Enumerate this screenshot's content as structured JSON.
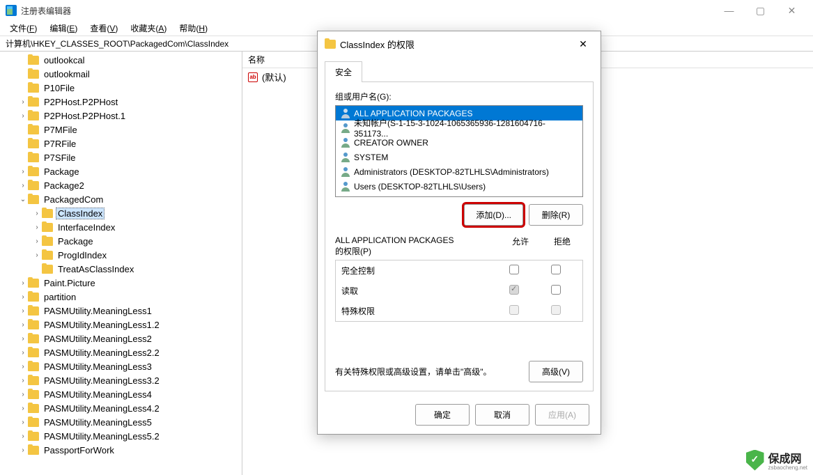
{
  "window": {
    "title": "注册表编辑器"
  },
  "menu": [
    {
      "label": "文件(F)"
    },
    {
      "label": "编辑(E)"
    },
    {
      "label": "查看(V)"
    },
    {
      "label": "收藏夹(A)"
    },
    {
      "label": "帮助(H)"
    }
  ],
  "address": "计算机\\HKEY_CLASSES_ROOT\\PackagedCom\\ClassIndex",
  "tree": [
    {
      "label": "outlookcal",
      "level": 1,
      "exp": ""
    },
    {
      "label": "outlookmail",
      "level": 1,
      "exp": ""
    },
    {
      "label": "P10File",
      "level": 1,
      "exp": ""
    },
    {
      "label": "P2PHost.P2PHost",
      "level": 1,
      "exp": ">"
    },
    {
      "label": "P2PHost.P2PHost.1",
      "level": 1,
      "exp": ">"
    },
    {
      "label": "P7MFile",
      "level": 1,
      "exp": ""
    },
    {
      "label": "P7RFile",
      "level": 1,
      "exp": ""
    },
    {
      "label": "P7SFile",
      "level": 1,
      "exp": ""
    },
    {
      "label": "Package",
      "level": 1,
      "exp": ">"
    },
    {
      "label": "Package2",
      "level": 1,
      "exp": ">"
    },
    {
      "label": "PackagedCom",
      "level": 1,
      "exp": "v"
    },
    {
      "label": "ClassIndex",
      "level": 2,
      "exp": ">",
      "selected": true
    },
    {
      "label": "InterfaceIndex",
      "level": 2,
      "exp": ">"
    },
    {
      "label": "Package",
      "level": 2,
      "exp": ">"
    },
    {
      "label": "ProgIdIndex",
      "level": 2,
      "exp": ">"
    },
    {
      "label": "TreatAsClassIndex",
      "level": 2,
      "exp": ""
    },
    {
      "label": "Paint.Picture",
      "level": 1,
      "exp": ">"
    },
    {
      "label": "partition",
      "level": 1,
      "exp": ">"
    },
    {
      "label": "PASMUtility.MeaningLess1",
      "level": 1,
      "exp": ">"
    },
    {
      "label": "PASMUtility.MeaningLess1.2",
      "level": 1,
      "exp": ">"
    },
    {
      "label": "PASMUtility.MeaningLess2",
      "level": 1,
      "exp": ">"
    },
    {
      "label": "PASMUtility.MeaningLess2.2",
      "level": 1,
      "exp": ">"
    },
    {
      "label": "PASMUtility.MeaningLess3",
      "level": 1,
      "exp": ">"
    },
    {
      "label": "PASMUtility.MeaningLess3.2",
      "level": 1,
      "exp": ">"
    },
    {
      "label": "PASMUtility.MeaningLess4",
      "level": 1,
      "exp": ">"
    },
    {
      "label": "PASMUtility.MeaningLess4.2",
      "level": 1,
      "exp": ">"
    },
    {
      "label": "PASMUtility.MeaningLess5",
      "level": 1,
      "exp": ">"
    },
    {
      "label": "PASMUtility.MeaningLess5.2",
      "level": 1,
      "exp": ">"
    },
    {
      "label": "PassportForWork",
      "level": 1,
      "exp": ">"
    }
  ],
  "list": {
    "header": "名称",
    "rows": [
      {
        "icon": "ab",
        "name": "(默认)"
      }
    ]
  },
  "dialog": {
    "title": "ClassIndex 的权限",
    "tab": "安全",
    "group_label": "组或用户名(G):",
    "groups": [
      {
        "name": "ALL APPLICATION PACKAGES",
        "selected": true
      },
      {
        "name": "未知帐户(S-1-15-3-1024-1065365936-1281604716-351173..."
      },
      {
        "name": "CREATOR OWNER"
      },
      {
        "name": "SYSTEM"
      },
      {
        "name": "Administrators (DESKTOP-82TLHLS\\Administrators)"
      },
      {
        "name": "Users (DESKTOP-82TLHLS\\Users)"
      }
    ],
    "add_btn": "添加(D)...",
    "remove_btn": "删除(R)",
    "perm_title_1": "ALL APPLICATION PACKAGES",
    "perm_title_2": "的权限(P)",
    "allow": "允许",
    "deny": "拒绝",
    "perms": [
      {
        "label": "完全控制",
        "allow": "unchecked",
        "deny": "unchecked"
      },
      {
        "label": "读取",
        "allow": "checked-disabled",
        "deny": "unchecked"
      },
      {
        "label": "特殊权限",
        "allow": "disabled",
        "deny": "disabled"
      }
    ],
    "adv_text": "有关特殊权限或高级设置，请单击\"高级\"。",
    "adv_btn": "高级(V)",
    "ok": "确定",
    "cancel": "取消",
    "apply": "应用(A)"
  },
  "watermark": {
    "name": "保成网",
    "url": "zsbaocheng.net"
  }
}
